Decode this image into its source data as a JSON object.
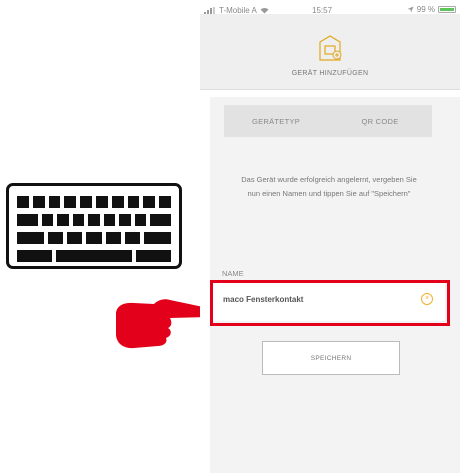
{
  "status_bar": {
    "carrier": "T-Mobile A",
    "time": "15:57",
    "battery": "99 %",
    "battery_level": 0.99
  },
  "header": {
    "title": "GERÄT HINZUFÜGEN",
    "icon": "add-device-icon"
  },
  "tabs": [
    {
      "label": "GERÄTETYP"
    },
    {
      "label": "QR CODE"
    }
  ],
  "message": "Das Gerät wurde erfolgreich angelernt, vergeben Sie nun einen Namen und tippen Sie auf \"Speichern\"",
  "name_field": {
    "label": "NAME",
    "value": "maco Fensterkontakt",
    "clear_icon": "clear-icon"
  },
  "save_button": {
    "label": "SPEICHERN"
  },
  "annotations": {
    "keyboard_icon": "keyboard-icon",
    "pointer_icon": "pointing-hand-icon",
    "highlight_color": "#e2001a"
  }
}
